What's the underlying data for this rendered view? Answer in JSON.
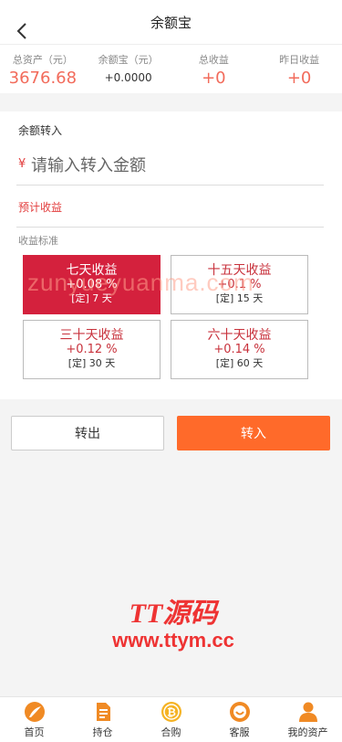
{
  "header": {
    "title": "余额宝"
  },
  "stats": [
    {
      "label": "总资产（元）",
      "value": "3676.68"
    },
    {
      "label": "余额宝（元）",
      "value": "+0.0000"
    },
    {
      "label": "总收益",
      "value": "+0"
    },
    {
      "label": "昨日收益",
      "value": "+0"
    }
  ],
  "transfer": {
    "section_title": "余额转入",
    "currency_symbol": "¥",
    "amount_placeholder": "请输入转入金额",
    "expected_label": "预计收益",
    "standard_label": "收益标准"
  },
  "options": [
    {
      "name": "七天收益",
      "rate": "+0.08 %",
      "term": "[定] 7 天",
      "selected": true
    },
    {
      "name": "十五天收益",
      "rate": "+0.1 %",
      "term": "[定] 15 天",
      "selected": false
    },
    {
      "name": "三十天收益",
      "rate": "+0.12 %",
      "term": "[定] 30 天",
      "selected": false
    },
    {
      "name": "六十天收益",
      "rate": "+0.14 %",
      "term": "[定] 60 天",
      "selected": false
    }
  ],
  "buttons": {
    "transfer_out": "转出",
    "transfer_in": "转入"
  },
  "watermark": {
    "text": "zunyueyuanma.com"
  },
  "logo": {
    "top": "TT源码",
    "bottom": "www.ttym.cc"
  },
  "tabbar": [
    {
      "label": "首页",
      "icon": "home-icon"
    },
    {
      "label": "持仓",
      "icon": "document-icon"
    },
    {
      "label": "合购",
      "icon": "bitcoin-icon"
    },
    {
      "label": "客服",
      "icon": "service-icon"
    },
    {
      "label": "我的资产",
      "icon": "user-icon"
    }
  ],
  "colors": {
    "accent_red": "#d4213d",
    "accent_orange": "#ff6a2a",
    "stat_red": "#f26b5b",
    "tab_orange": "#f08a24"
  }
}
